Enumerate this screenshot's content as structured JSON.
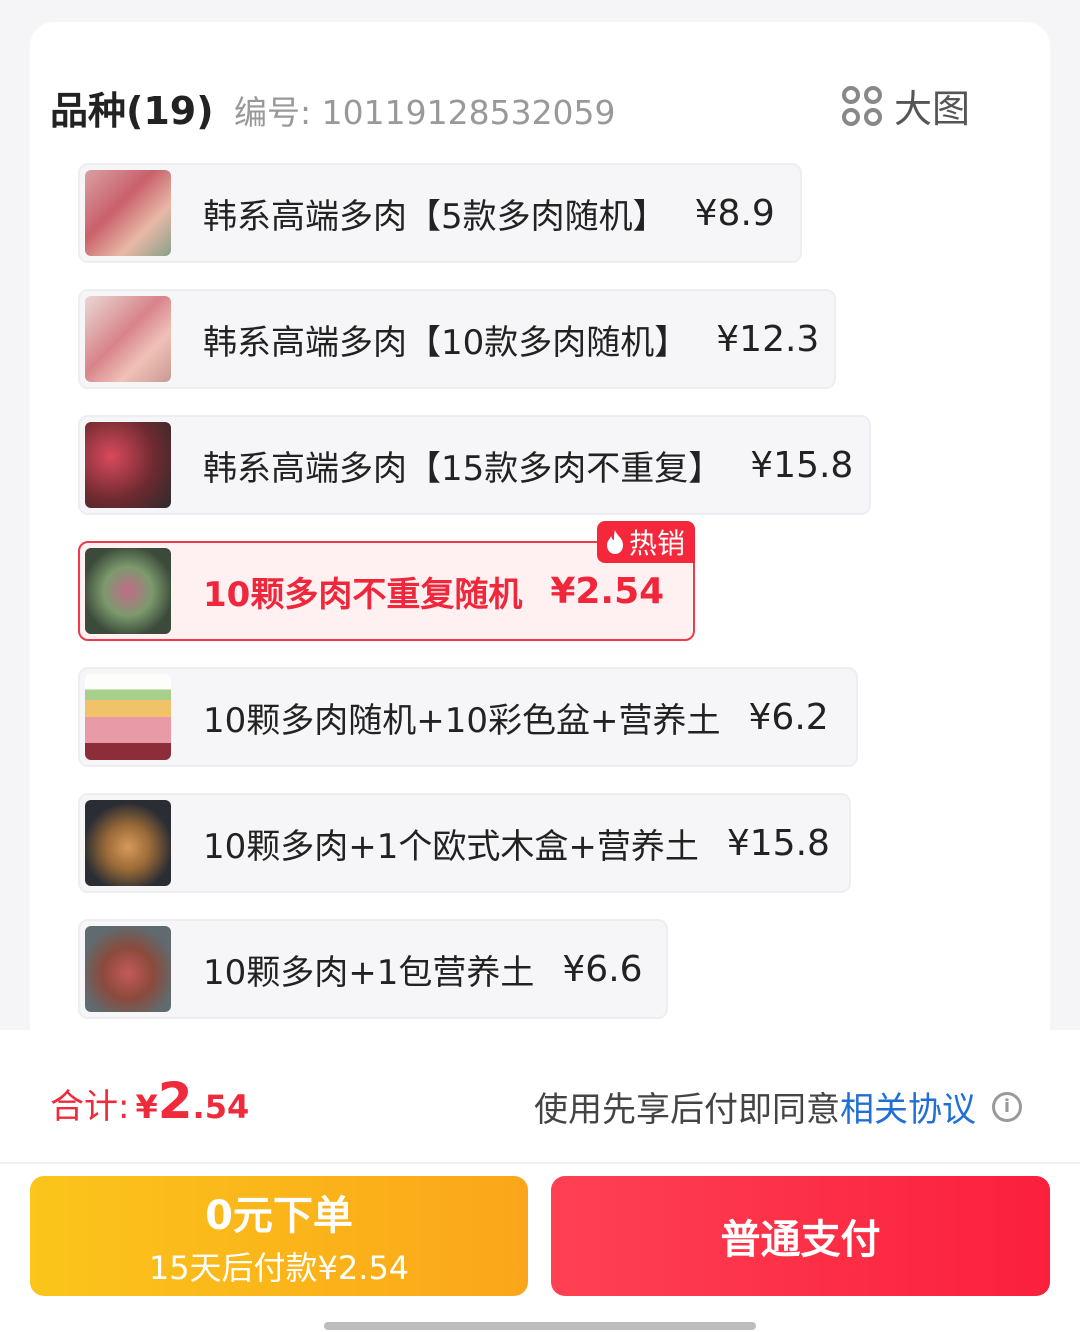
{
  "header": {
    "variety_title": "品种(19)",
    "sku_code": "编号: 10119128532059",
    "bigview_label": "大图",
    "bigview_icon": "grid-circles-icon"
  },
  "options": [
    {
      "text": "韩系高端多肉【5款多肉随机】",
      "price": "¥8.9",
      "selected": false
    },
    {
      "text": "韩系高端多肉【10款多肉随机】",
      "price": "¥12.3",
      "selected": false
    },
    {
      "text": "韩系高端多肉【15款多肉不重复】",
      "price": "¥15.8",
      "selected": false
    },
    {
      "text": "10颗多肉不重复随机",
      "price": "¥2.54",
      "selected": true,
      "badge": "热销"
    },
    {
      "text": "10颗多肉随机+10彩色盆+营养土",
      "price": "¥6.2",
      "selected": false
    },
    {
      "text": "10颗多肉+1个欧式木盒+营养土",
      "price": "¥15.8",
      "selected": false
    },
    {
      "text": "10颗多肉+1包营养土",
      "price": "¥6.6",
      "selected": false
    }
  ],
  "footer": {
    "total_label": "合计:",
    "total_currency": "¥",
    "total_integer": "2",
    "total_decimal": ".54",
    "agreement_text": "使用先享后付即同意",
    "agreement_link": "相关协议",
    "pay_later_line1": "0元下单",
    "pay_later_line2": "15天后付款¥2.54",
    "pay_now_label": "普通支付"
  },
  "colors": {
    "accent_red": "#f0263a",
    "pay_later_yellow": "#fbb91a",
    "link_blue": "#1f6fd6"
  }
}
